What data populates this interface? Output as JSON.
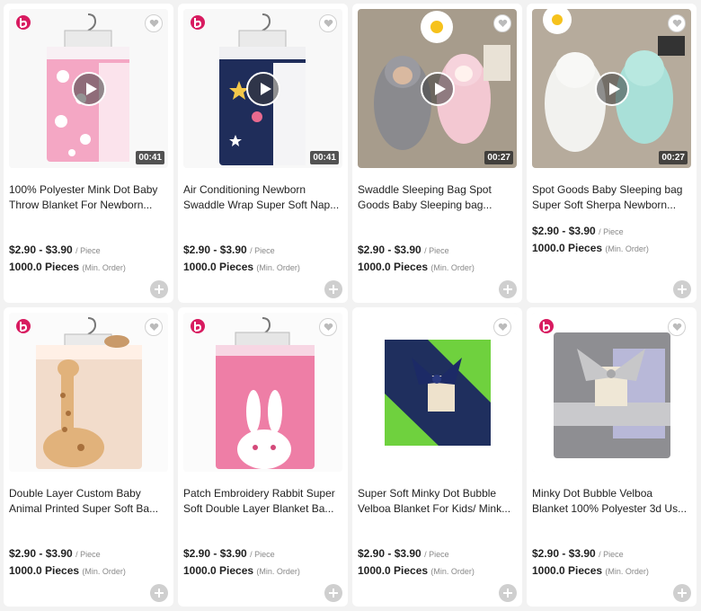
{
  "colors": {
    "brand_logo": "#d81b60",
    "card_bg": "#ffffff",
    "page_bg": "#f2f2f2",
    "add_button": "#cfcfcf"
  },
  "products": [
    {
      "title": "100% Polyester Mink Dot Baby Throw Blanket For Newborn...",
      "price": "$2.90 - $3.90",
      "unit": "/ Piece",
      "moq": "1000.0 Pieces",
      "moq_label": "(Min. Order)",
      "has_video": true,
      "duration": "00:41",
      "has_brand_logo": true,
      "image_icon": "pink-unicorn-blanket-image"
    },
    {
      "title": "Air Conditioning Newborn Swaddle Wrap Super Soft Nap...",
      "price": "$2.90 - $3.90",
      "unit": "/ Piece",
      "moq": "1000.0 Pieces",
      "moq_label": "(Min. Order)",
      "has_video": true,
      "duration": "00:41",
      "has_brand_logo": true,
      "image_icon": "navy-star-blanket-image"
    },
    {
      "title": "Swaddle Sleeping Bag Spot Goods Baby Sleeping bag...",
      "price": "$2.90 - $3.90",
      "unit": "/ Piece",
      "moq": "1000.0 Pieces",
      "moq_label": "(Min. Order)",
      "has_video": true,
      "duration": "00:27",
      "has_brand_logo": false,
      "image_icon": "sherpa-sleeping-bags-image"
    },
    {
      "title": "Spot Goods Baby Sleeping bag Super Soft Sherpa Newborn...",
      "price": "$2.90 - $3.90",
      "unit": "/ Piece",
      "moq": "1000.0 Pieces",
      "moq_label": "(Min. Order)",
      "has_video": true,
      "duration": "00:27",
      "has_brand_logo": false,
      "image_icon": "white-mint-sleeping-bags-image"
    },
    {
      "title": "Double Layer Custom Baby Animal Printed Super Soft Ba...",
      "price": "$2.90 - $3.90",
      "unit": "/ Piece",
      "moq": "1000.0 Pieces",
      "moq_label": "(Min. Order)",
      "has_video": false,
      "duration": "",
      "has_brand_logo": true,
      "image_icon": "giraffe-blanket-image"
    },
    {
      "title": "Patch Embroidery Rabbit Super Soft Double Layer Blanket Ba...",
      "price": "$2.90 - $3.90",
      "unit": "/ Piece",
      "moq": "1000.0 Pieces",
      "moq_label": "(Min. Order)",
      "has_video": false,
      "duration": "",
      "has_brand_logo": true,
      "image_icon": "rabbit-blanket-image"
    },
    {
      "title": "Super Soft Minky Dot Bubble Velboa Blanket For Kids/ Mink...",
      "price": "$2.90 - $3.90",
      "unit": "/ Piece",
      "moq": "1000.0 Pieces",
      "moq_label": "(Min. Order)",
      "has_video": false,
      "duration": "",
      "has_brand_logo": false,
      "image_icon": "navy-green-minky-blanket-image"
    },
    {
      "title": "Minky Dot Bubble Velboa Blanket 100% Polyester 3d Us...",
      "price": "$2.90 - $3.90",
      "unit": "/ Piece",
      "moq": "1000.0 Pieces",
      "moq_label": "(Min. Order)",
      "has_video": false,
      "duration": "",
      "has_brand_logo": true,
      "image_icon": "grey-minky-blanket-image"
    }
  ]
}
